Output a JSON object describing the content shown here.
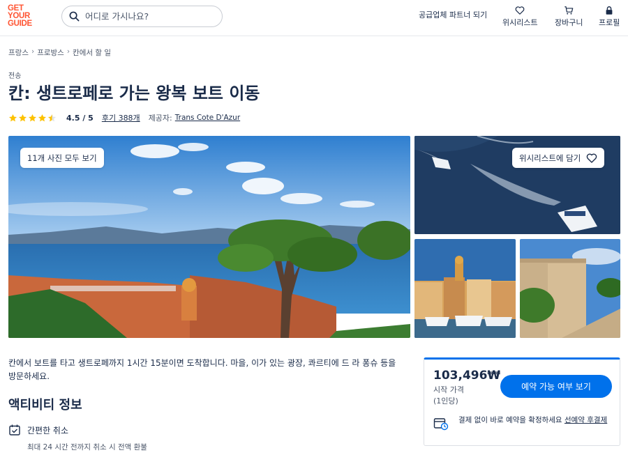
{
  "header": {
    "logo_lines": [
      "GET",
      "YOUR",
      "GUIDE"
    ],
    "search_placeholder": "어디로 가시나요?",
    "partner_label": "공급업체 파트너 되기",
    "wishlist_label": "위시리스트",
    "cart_label": "장바구니",
    "profile_label": "프로필"
  },
  "breadcrumb": [
    "프랑스",
    "프로방스",
    "칸에서 할 일"
  ],
  "category": "전송",
  "title": "칸: 생트로페로 가는 왕복 보트 이동",
  "rating": {
    "value": 4.5,
    "value_label": "4.5 / 5",
    "reviews_label": "후기 388개",
    "provider_label": "제공자:",
    "provider_name": "Trans Cote D'Azur"
  },
  "gallery": {
    "all_photos_label": "11개 사진 모두 보기",
    "wishlist_add_label": "위시리스트에 담기"
  },
  "description": "칸에서 보트를 타고 생트로페까지 1시간 15분이면 도착합니다. 마을, 이가 있는 광장, 콰르티에 드 라 퐁슈 등을 방문하세요.",
  "activity_info": {
    "title": "액티비티 정보",
    "cancel_title": "간편한 취소",
    "cancel_sub": "최대 24 시간 전까지 취소 시 전액 환불"
  },
  "booking": {
    "price": "103,496₩",
    "price_from": "시작 가격",
    "per_person": "(1인당)",
    "check_button": "예약 가능 여부 보기",
    "reserve_text": "결제 없이 바로 예약을 확정하세요",
    "reserve_link": "선예약 후결제"
  },
  "colors": {
    "brand": "#ff5533",
    "primary": "#0071eb",
    "text": "#1a2b49",
    "star": "#fdc100"
  }
}
